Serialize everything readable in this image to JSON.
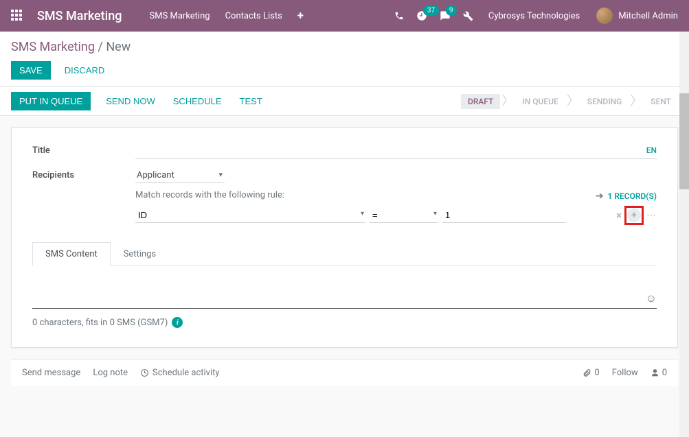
{
  "navbar": {
    "brand": "SMS Marketing",
    "links": [
      "SMS Marketing",
      "Contacts Lists"
    ],
    "activities_badge": "37",
    "messages_badge": "9",
    "company": "Cybrosys Technologies",
    "user": "Mitchell Admin"
  },
  "breadcrumb": {
    "parent": "SMS Marketing",
    "sep": " / ",
    "current": "New"
  },
  "cp_actions": {
    "save": "SAVE",
    "discard": "DISCARD"
  },
  "statusbar_buttons": {
    "put_in_queue": "PUT IN QUEUE",
    "send_now": "SEND NOW",
    "schedule": "SCHEDULE",
    "test": "TEST"
  },
  "status_steps": [
    "DRAFT",
    "IN QUEUE",
    "SENDING",
    "SENT"
  ],
  "form": {
    "labels": {
      "title": "Title",
      "recipients": "Recipients"
    },
    "lang": "EN",
    "recipient_model": "Applicant",
    "match_text": "Match records with the following rule:",
    "rule": {
      "field": "ID",
      "operator": "=",
      "value": "1"
    },
    "records_link": "1 RECORD(S)"
  },
  "tabs": {
    "sms_content": "SMS Content",
    "settings": "Settings"
  },
  "sms": {
    "counter": "0 characters, fits in 0 SMS (GSM7)"
  },
  "chatter": {
    "send_message": "Send message",
    "log_note": "Log note",
    "schedule_activity": "Schedule activity",
    "attach_count": "0",
    "follow": "Follow",
    "followers": "0"
  }
}
